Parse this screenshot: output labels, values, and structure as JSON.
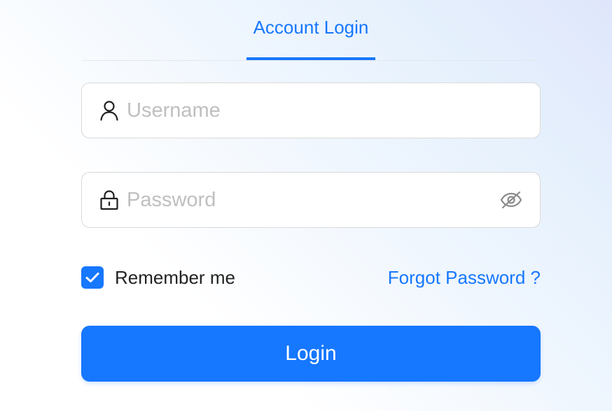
{
  "tabs": [
    {
      "label": "Account Login",
      "active": true
    }
  ],
  "username": {
    "placeholder": "Username",
    "value": "",
    "icon": "user-icon"
  },
  "password": {
    "placeholder": "Password",
    "value": "",
    "icon": "lock-icon",
    "toggle_icon": "eye-off-icon"
  },
  "remember": {
    "label": "Remember me",
    "checked": true
  },
  "forgot_password": {
    "label": "Forgot Password ?"
  },
  "login_button": {
    "label": "Login"
  },
  "colors": {
    "accent": "#1677ff",
    "border": "#d9d9d9",
    "placeholder": "#bfbfbf",
    "text": "#222222"
  }
}
